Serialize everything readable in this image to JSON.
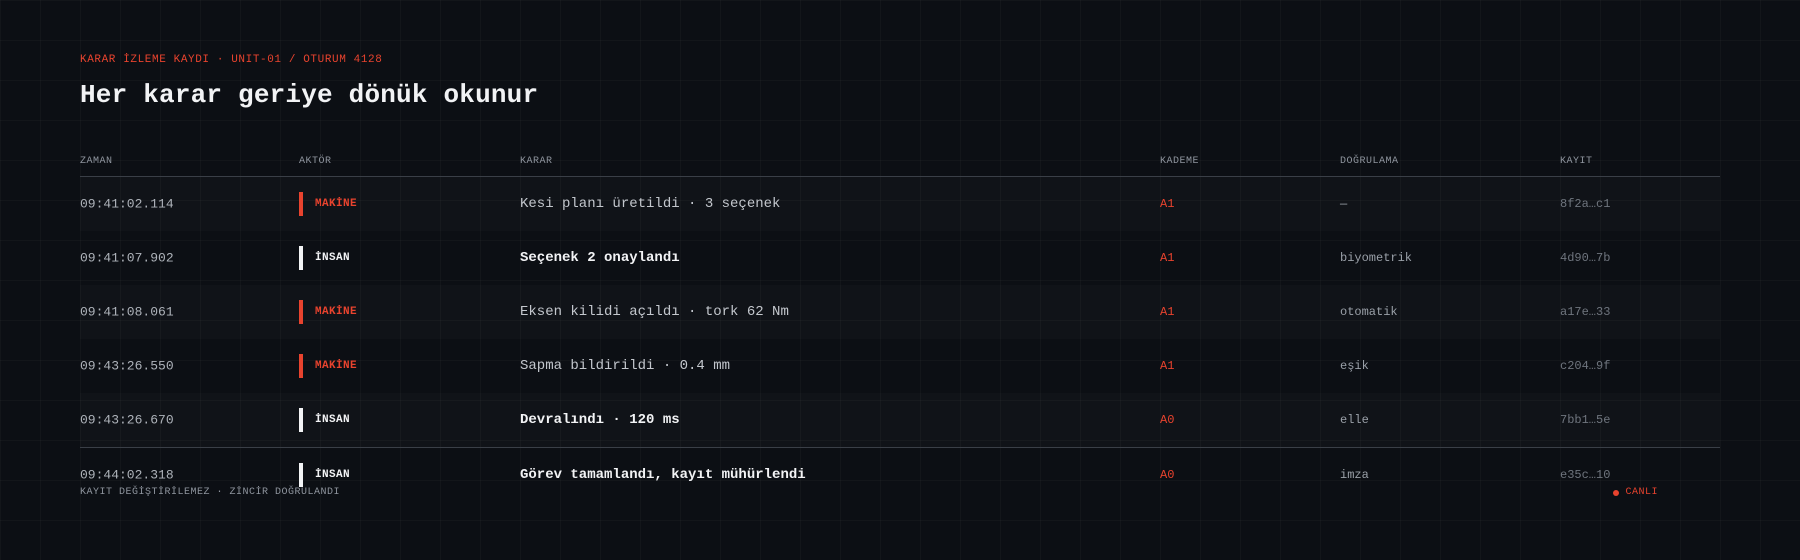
{
  "header": {
    "eyebrow": "KARAR İZLEME KAYDI · UNIT-01 / OTURUM 4128",
    "title": "Her karar geriye dönük okunur"
  },
  "table": {
    "columns": [
      "ZAMAN",
      "AKTÖR",
      "KARAR",
      "KADEME",
      "DOĞRULAMA",
      "KAYIT"
    ],
    "rows": [
      {
        "time": "09:41:02.114",
        "actor": "MAKİNE",
        "decision": "Kesi planı üretildi · 3 seçenek",
        "level": "A1",
        "verification": "—",
        "record": "8f2a…c1"
      },
      {
        "time": "09:41:07.902",
        "actor": "İNSAN",
        "decision": "Seçenek 2 onaylandı",
        "level": "A1",
        "verification": "biyometrik",
        "record": "4d90…7b"
      },
      {
        "time": "09:41:08.061",
        "actor": "MAKİNE",
        "decision": "Eksen kilidi açıldı · tork 62 Nm",
        "level": "A1",
        "verification": "otomatik",
        "record": "a17e…33"
      },
      {
        "time": "09:43:26.550",
        "actor": "MAKİNE",
        "decision": "Sapma bildirildi · 0.4 mm",
        "level": "A1",
        "verification": "eşik",
        "record": "c204…9f"
      },
      {
        "time": "09:43:26.670",
        "actor": "İNSAN",
        "decision": "Devralındı · 120 ms",
        "level": "A0",
        "verification": "elle",
        "record": "7bb1…5e"
      },
      {
        "time": "09:44:02.318",
        "actor": "İNSAN",
        "decision": "Görev tamamlandı, kayıt mühürlendi",
        "level": "A0",
        "verification": "imza",
        "record": "e35c…10"
      }
    ]
  },
  "footer": {
    "integrity": "KAYIT DEĞİŞTİRİLEMEZ · ZİNCİR DOĞRULANDI",
    "live_label": "CANLI"
  },
  "colors": {
    "accent": "#e8432e",
    "background": "#0c0f14",
    "human": "#f2f3f5"
  },
  "icons": {
    "live": "live-dot-icon"
  }
}
